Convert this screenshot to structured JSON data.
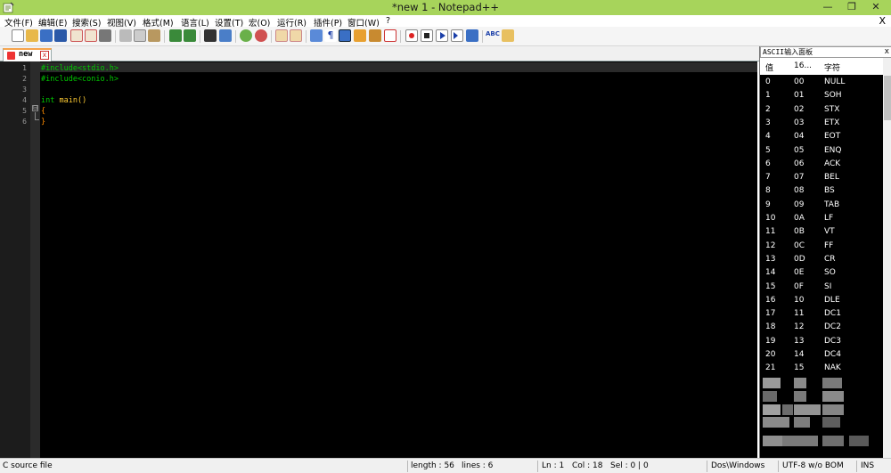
{
  "window": {
    "title": "*new  1 - Notepad++",
    "minimize_glyph": "—",
    "maximize_glyph": "❐",
    "close_glyph": "✕"
  },
  "menu": {
    "items": [
      "文件(F)",
      "编辑(E)",
      "搜索(S)",
      "视图(V)",
      "格式(M)",
      "语言(L)",
      "设置(T)",
      "宏(O)",
      "运行(R)",
      "插件(P)",
      "窗口(W)",
      "?"
    ],
    "close_doc": "X"
  },
  "toolbar": {
    "icons": [
      "new-file-icon",
      "open-file-icon",
      "save-icon",
      "save-all-icon",
      "close-icon",
      "close-all-icon",
      "print-icon",
      "cut-icon",
      "copy-icon",
      "paste-icon",
      "undo-icon",
      "redo-icon",
      "find-icon",
      "replace-icon",
      "zoom-in-icon",
      "zoom-out-icon",
      "sync-v-icon",
      "sync-h-icon",
      "wrap-icon",
      "all-chars-icon",
      "indent-guide-icon",
      "doc-map-icon",
      "function-list-icon",
      "folder-workspace-icon",
      "record-macro-icon",
      "stop-macro-icon",
      "play-macro-icon",
      "run-macro-multiple-icon",
      "save-macro-icon",
      "spellcheck-icon",
      "abc-icon"
    ],
    "spell_label": "ABC"
  },
  "tab": {
    "label": "new",
    "close_glyph": "x"
  },
  "editor": {
    "line_numbers": [
      "1",
      "2",
      "3",
      "4",
      "5",
      "6"
    ],
    "lines": [
      {
        "text": "#include<stdio.h>",
        "color": "#00c800"
      },
      {
        "text": "#include<conio.h>",
        "color": "#00c800"
      },
      {
        "text": "",
        "color": "#ffffff"
      },
      {
        "text": "int main()",
        "color": "#ffcc33",
        "int_color": "#00c800"
      },
      {
        "text": "{",
        "color": "#ff8c00"
      },
      {
        "text": "}",
        "color": "#ff8c00"
      }
    ],
    "fold_open_glyph": "⊟"
  },
  "ascii_panel": {
    "title": "ASCII输入面板",
    "close_glyph": "x",
    "columns": [
      "值",
      "16...",
      "字符"
    ],
    "rows": [
      [
        "0",
        "00",
        "NULL"
      ],
      [
        "1",
        "01",
        "SOH"
      ],
      [
        "2",
        "02",
        "STX"
      ],
      [
        "3",
        "03",
        "ETX"
      ],
      [
        "4",
        "04",
        "EOT"
      ],
      [
        "5",
        "05",
        "ENQ"
      ],
      [
        "6",
        "06",
        "ACK"
      ],
      [
        "7",
        "07",
        "BEL"
      ],
      [
        "8",
        "08",
        "BS"
      ],
      [
        "9",
        "09",
        "TAB"
      ],
      [
        "10",
        "0A",
        "LF"
      ],
      [
        "11",
        "0B",
        "VT"
      ],
      [
        "12",
        "0C",
        "FF"
      ],
      [
        "13",
        "0D",
        "CR"
      ],
      [
        "14",
        "0E",
        "SO"
      ],
      [
        "15",
        "0F",
        "SI"
      ],
      [
        "16",
        "10",
        "DLE"
      ],
      [
        "17",
        "11",
        "DC1"
      ],
      [
        "18",
        "12",
        "DC2"
      ],
      [
        "19",
        "13",
        "DC3"
      ],
      [
        "20",
        "14",
        "DC4"
      ],
      [
        "21",
        "15",
        "NAK"
      ]
    ]
  },
  "status": {
    "file_type": "C source file",
    "length": "length : 56",
    "lines": "lines : 6",
    "ln": "Ln : 1",
    "col": "Col : 18",
    "sel": "Sel : 0 | 0",
    "eol": "Dos\\Windows",
    "encoding": "UTF-8 w/o BOM",
    "mode": "INS"
  },
  "colors": {
    "titlebar": "#a7d45b",
    "editor_bg": "#000000",
    "gutter_bg": "#1c1c1c",
    "tab_accent": "#f6a44c"
  }
}
